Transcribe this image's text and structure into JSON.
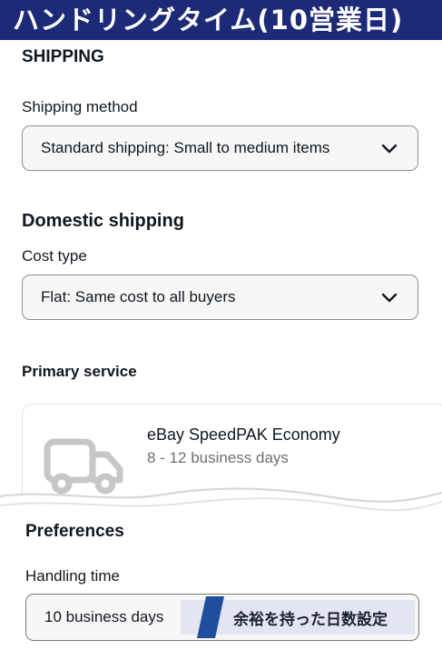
{
  "banner": {
    "text": "ハンドリングタイム(10営業日)"
  },
  "shipping": {
    "section_title": "SHIPPING",
    "method_label": "Shipping method",
    "method_value": "Standard shipping: Small to medium items"
  },
  "domestic": {
    "title": "Domestic shipping",
    "cost_type_label": "Cost type",
    "cost_type_value": "Flat: Same cost to all buyers",
    "primary_service_label": "Primary service",
    "service": {
      "name": "eBay SpeedPAK Economy",
      "days": "8 - 12 business days",
      "icon": "truck-icon"
    }
  },
  "preferences": {
    "title": "Preferences",
    "handling_label": "Handling time",
    "handling_value": "10 business days",
    "annotation": "余裕を持った日数設定"
  },
  "colors": {
    "banner_bg": "#1d2a78",
    "annotation_stripe": "#1f4e9e",
    "annotation_bg": "#e3e6f0"
  }
}
